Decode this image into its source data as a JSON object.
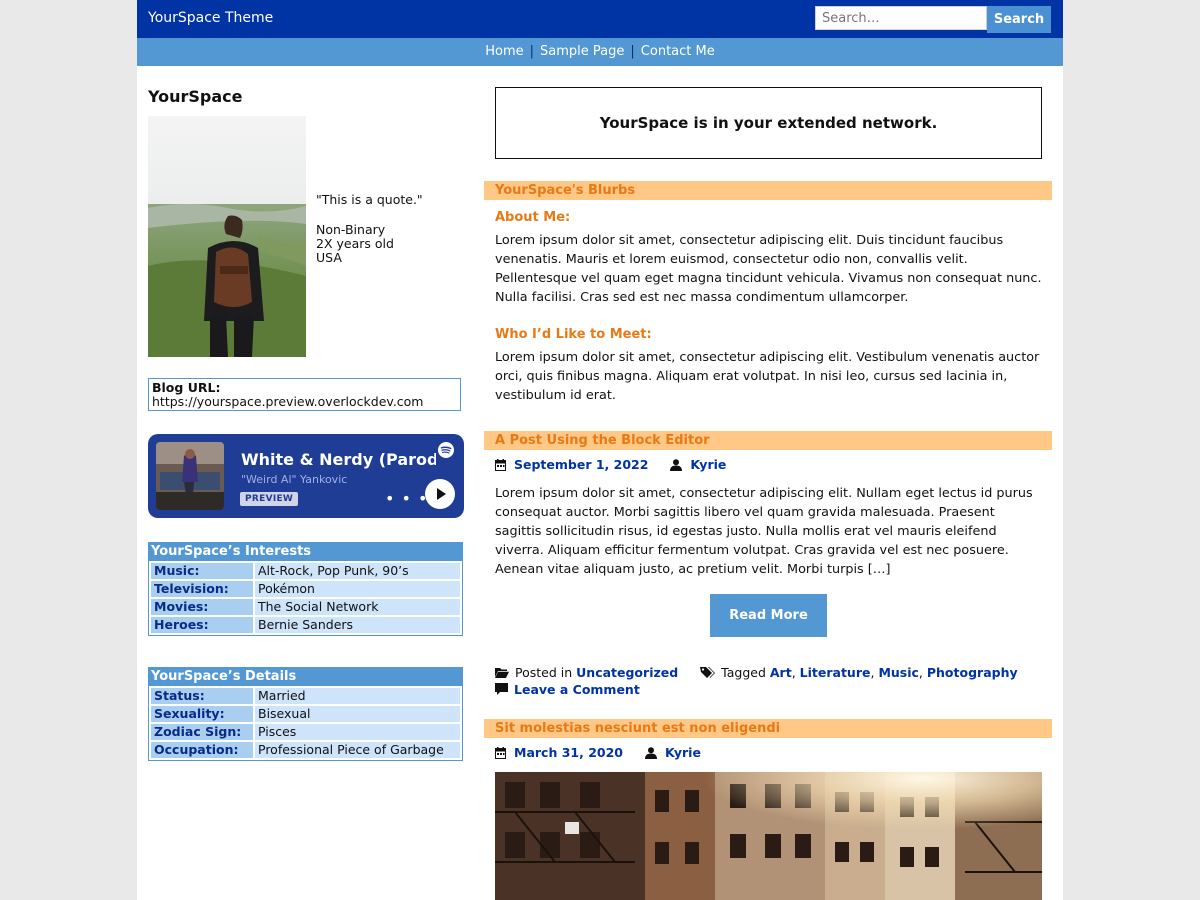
{
  "header": {
    "site_title": "YourSpace Theme",
    "search_placeholder": "Search…",
    "search_button": "Search"
  },
  "nav": {
    "items": [
      "Home",
      "Sample Page",
      "Contact Me"
    ],
    "separator": "|"
  },
  "profile": {
    "name": "YourSpace",
    "quote": "\"This is a quote.\"",
    "gender": "Non-Binary",
    "age": "2X years old",
    "country": "USA",
    "blog_url_label": "Blog URL:",
    "blog_url": "https://yourspace.preview.overlockdev.com"
  },
  "spotify": {
    "title": "White & Nerdy (Parody of “Ridin’”)",
    "artist": "\"Weird Al\" Yankovic",
    "preview_label": "PREVIEW",
    "dots": "• • •",
    "colors": {
      "background": "#1f3d95"
    }
  },
  "interests": {
    "title": "YourSpace’s Interests",
    "rows": [
      {
        "key": "Music:",
        "value": "Alt-Rock, Pop Punk, 90’s"
      },
      {
        "key": "Television:",
        "value": "Pokémon"
      },
      {
        "key": "Movies:",
        "value": "The Social Network"
      },
      {
        "key": "Heroes:",
        "value": "Bernie Sanders"
      }
    ]
  },
  "details": {
    "title": "YourSpace’s Details",
    "rows": [
      {
        "key": "Status:",
        "value": "Married"
      },
      {
        "key": "Sexuality:",
        "value": "Bisexual"
      },
      {
        "key": "Zodiac Sign:",
        "value": "Pisces"
      },
      {
        "key": "Occupation:",
        "value": "Professional Piece of Garbage"
      }
    ]
  },
  "network_box": "YourSpace is in your extended network.",
  "blurbs": {
    "title": "YourSpace's Blurbs",
    "about_heading": "About Me:",
    "about_text": "Lorem ipsum dolor sit amet, consectetur adipiscing elit. Duis tincidunt faucibus venenatis. Mauris et lorem euismod, consectetur odio non, convallis velit. Pellentesque vel quam eget magna tincidunt vehicula. Vivamus non consequat nunc. Nulla facilisi. Cras sed est nec massa condimentum ullamcorper.",
    "meet_heading": "Who I’d Like to Meet:",
    "meet_text": "Lorem ipsum dolor sit amet, consectetur adipiscing elit. Vestibulum venenatis auctor orci, quis finibus magna. Aliquam erat volutpat. In nisi leo, cursus sed lacinia in, vestibulum id erat."
  },
  "post1": {
    "title": "A Post Using the Block Editor",
    "date": "September 1, 2022",
    "author": "Kyrie",
    "excerpt": "Lorem ipsum dolor sit amet, consectetur adipiscing elit. Nullam eget lectus id purus consequat auctor. Morbi sagittis libero vel quam gravida malesuada. Praesent sagittis sollicitudin risus, id egestas justo. Nulla mollis erat vel mauris eleifend viverra. Aliquam efficitur fermentum volutpat. Cras gravida vel est nec posuere. Aenean vitae aliquam justo, ac pretium velit. Morbi turpis […]",
    "read_more": "Read More",
    "posted_in_label": "Posted in",
    "category": "Uncategorized",
    "tagged_label": "Tagged",
    "tags": [
      "Art",
      "Literature",
      "Music",
      "Photography"
    ],
    "leave_comment": "Leave a Comment"
  },
  "post2": {
    "title": "Sit molestias nesciunt est non eligendi",
    "date": "March 31, 2020",
    "author": "Kyrie"
  },
  "colors": {
    "header_blue": "#0033a3",
    "nav_blue": "#5498d3",
    "section_orange_bg": "#ffc887",
    "section_orange_text": "#e87a16"
  }
}
